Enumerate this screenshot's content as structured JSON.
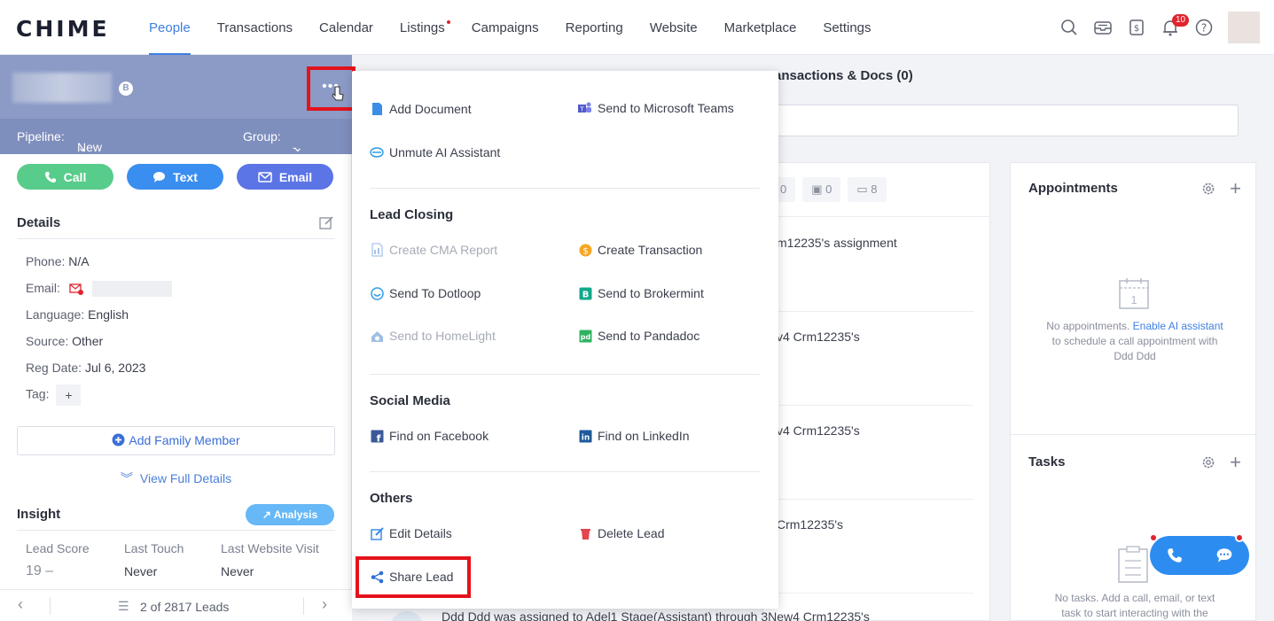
{
  "app": {
    "logo": "CHIME"
  },
  "nav": {
    "items": [
      "People",
      "Transactions",
      "Calendar",
      "Listings",
      "Campaigns",
      "Reporting",
      "Website",
      "Marketplace",
      "Settings"
    ],
    "active": "People",
    "notification_count": "10"
  },
  "lead": {
    "badge": "B",
    "pipeline_label": "Pipeline:",
    "pipeline_value": "New Leads",
    "group_label": "Group:",
    "group_value": "- -",
    "actions": {
      "call": "Call",
      "text": "Text",
      "email": "Email"
    }
  },
  "details": {
    "title": "Details",
    "phone_label": "Phone:",
    "phone_value": "N/A",
    "email_label": "Email:",
    "language_label": "Language:",
    "language_value": "English",
    "source_label": "Source:",
    "source_value": "Other",
    "reg_label": "Reg Date:",
    "reg_value": "Jul 6, 2023",
    "tag_label": "Tag:",
    "add_family": "Add Family Member",
    "view_full": "View Full Details"
  },
  "insight": {
    "title": "Insight",
    "analysis": "Analysis",
    "cols": [
      "Lead Score",
      "Last Touch",
      "Last Website Visit"
    ],
    "values": [
      "19 –",
      "Never",
      "Never"
    ]
  },
  "pager": {
    "text": "2 of 2817 Leads"
  },
  "middle": {
    "title": "ansactions & Docs (0)",
    "chips": [
      "0",
      "0",
      "8"
    ],
    "activities": [
      "m12235's assignment",
      "v4 Crm12235's",
      "v4 Crm12235's",
      "Crm12235's"
    ],
    "bottom_activity": "Ddd Ddd was assigned to Adel1 Stage(Assistant) through 3New4 Crm12235's"
  },
  "appointments": {
    "title": "Appointments",
    "calendar_day": "1",
    "empty_prefix": "No appointments. ",
    "empty_link": "Enable AI assistant",
    "empty_suffix": " to schedule a call appointment with Ddd Ddd"
  },
  "tasks": {
    "title": "Tasks",
    "empty": "No tasks. Add a call, email, or text task to start interacting with the"
  },
  "menu": {
    "top": {
      "add_document": "Add Document",
      "send_teams": "Send to Microsoft Teams",
      "unmute_ai": "Unmute AI Assistant"
    },
    "lead_closing": {
      "title": "Lead Closing",
      "create_cma": "Create CMA Report",
      "create_transaction": "Create Transaction",
      "send_dotloop": "Send To Dotloop",
      "send_brokermint": "Send to Brokermint",
      "send_homelight": "Send to HomeLight",
      "send_pandadoc": "Send to Pandadoc"
    },
    "social": {
      "title": "Social Media",
      "facebook": "Find on Facebook",
      "linkedin": "Find on LinkedIn"
    },
    "others": {
      "title": "Others",
      "edit": "Edit Details",
      "delete": "Delete Lead",
      "share": "Share Lead"
    }
  },
  "colors": {
    "accent": "#3f7fe0",
    "highlight": "#e4121b",
    "lead_header": "#8b9bc6"
  }
}
